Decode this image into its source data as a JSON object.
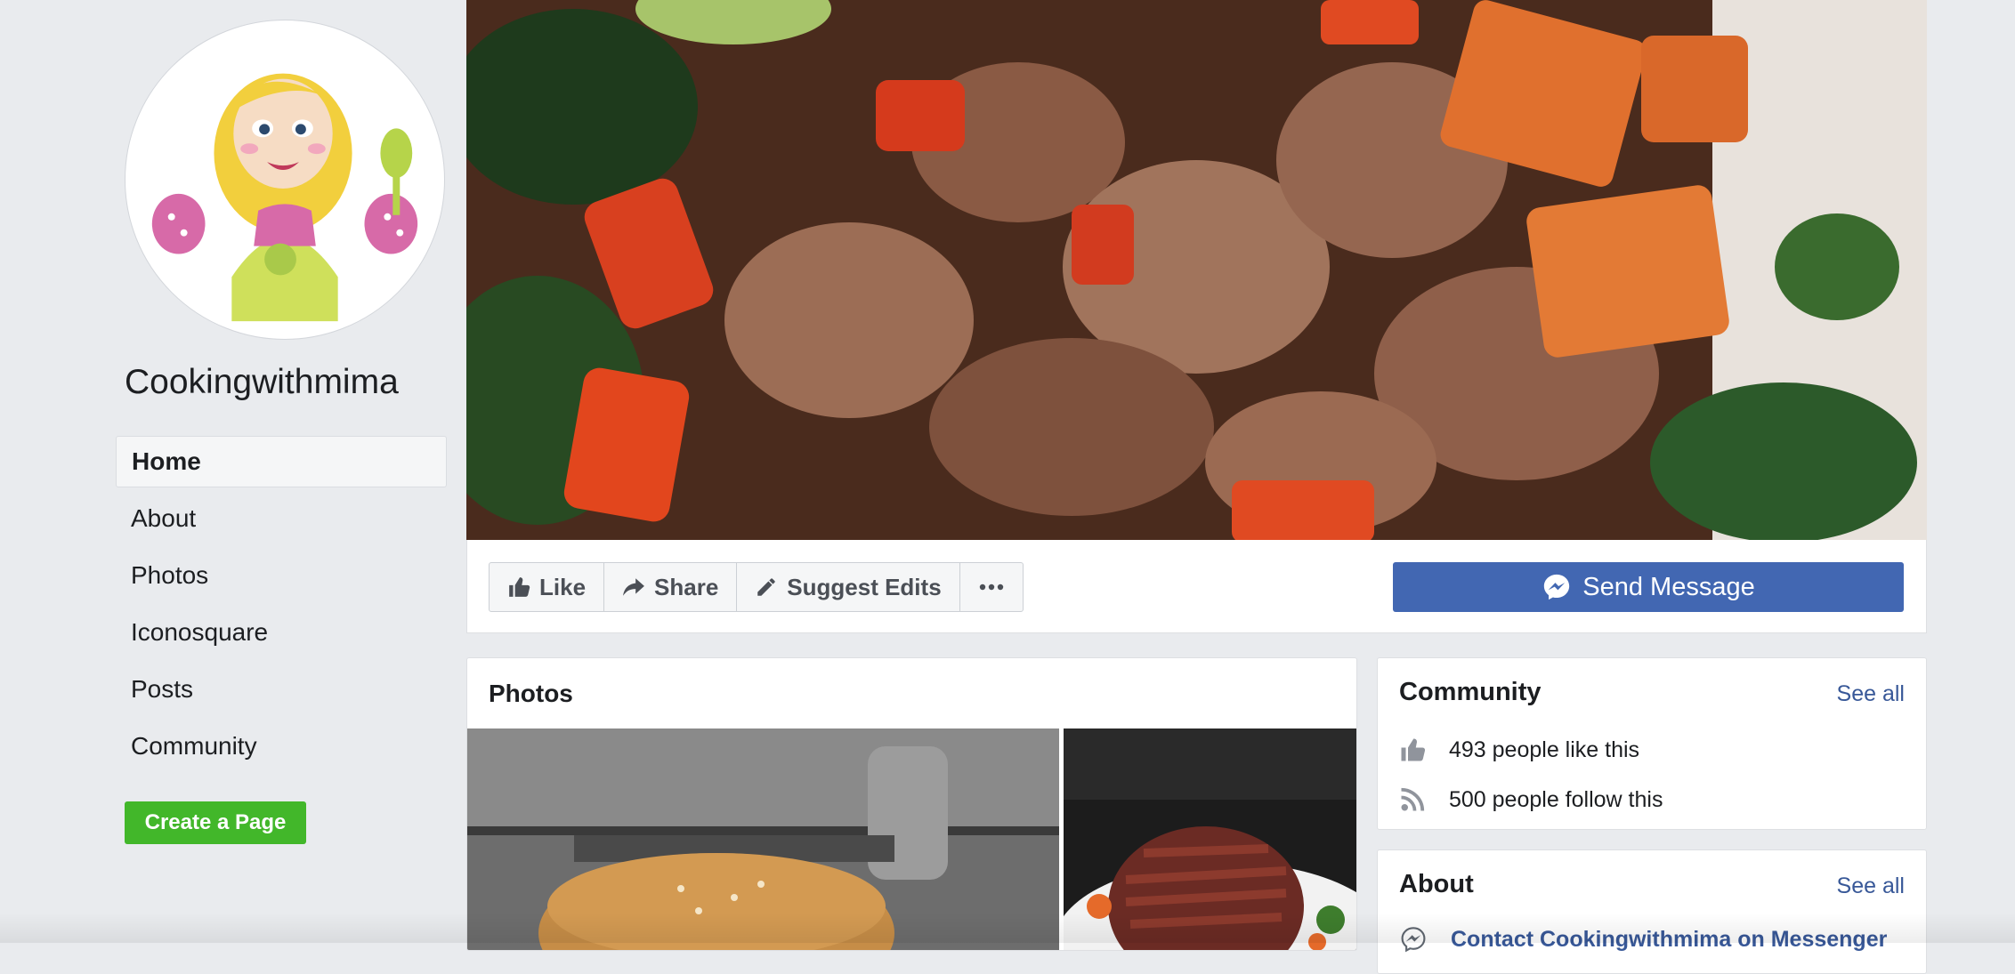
{
  "page": {
    "name": "Cookingwithmima"
  },
  "sidebar": {
    "items": [
      {
        "label": "Home",
        "active": true
      },
      {
        "label": "About"
      },
      {
        "label": "Photos"
      },
      {
        "label": "Iconosquare"
      },
      {
        "label": "Posts"
      },
      {
        "label": "Community"
      }
    ],
    "create_page_label": "Create a Page"
  },
  "actions": {
    "like": "Like",
    "share": "Share",
    "suggest_edits": "Suggest Edits",
    "more_icon": "ellipsis-icon",
    "send_message": "Send Message"
  },
  "photos": {
    "title": "Photos"
  },
  "community": {
    "title": "Community",
    "see_all": "See all",
    "likes_text": "493 people like this",
    "follows_text": "500 people follow this"
  },
  "about": {
    "title": "About",
    "see_all": "See all",
    "contact_text": "Contact Cookingwithmima on Messenger"
  },
  "colors": {
    "background": "#e9ebee",
    "brand_blue": "#4267b2",
    "link_blue": "#385898",
    "create_green": "#42b72a"
  }
}
